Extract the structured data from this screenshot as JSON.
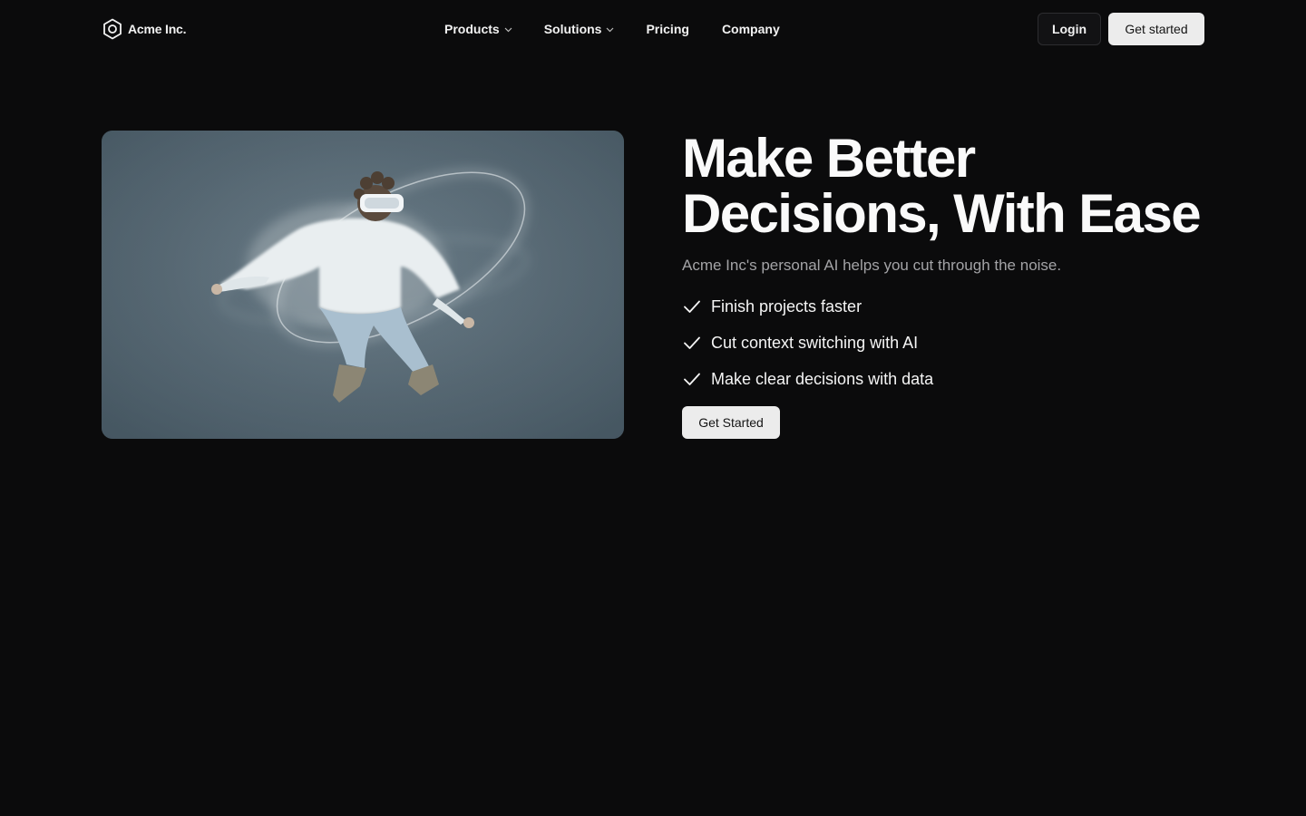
{
  "brand": {
    "name": "Acme Inc.",
    "logo_icon": "hexagon-logo-icon"
  },
  "nav": {
    "items": [
      {
        "label": "Products",
        "has_dropdown": true
      },
      {
        "label": "Solutions",
        "has_dropdown": true
      },
      {
        "label": "Pricing",
        "has_dropdown": false
      },
      {
        "label": "Company",
        "has_dropdown": false
      }
    ],
    "login_label": "Login",
    "get_started_label": "Get started"
  },
  "hero": {
    "image_icon": "vr-person-illustration",
    "headline_line1": "Make Better",
    "headline_line2": "Decisions, With Ease",
    "subtitle": "Acme Inc's personal AI helps you cut through the noise.",
    "features": [
      "Finish projects faster",
      "Cut context switching with AI",
      "Make clear decisions with data"
    ],
    "cta_label": "Get Started"
  },
  "colors": {
    "background": "#0b0b0c",
    "text_primary": "#fafafa",
    "text_muted": "#a3a3a6",
    "button_light": "#ececec",
    "button_dark": "#121214",
    "image_bg": "#5b6c77"
  }
}
